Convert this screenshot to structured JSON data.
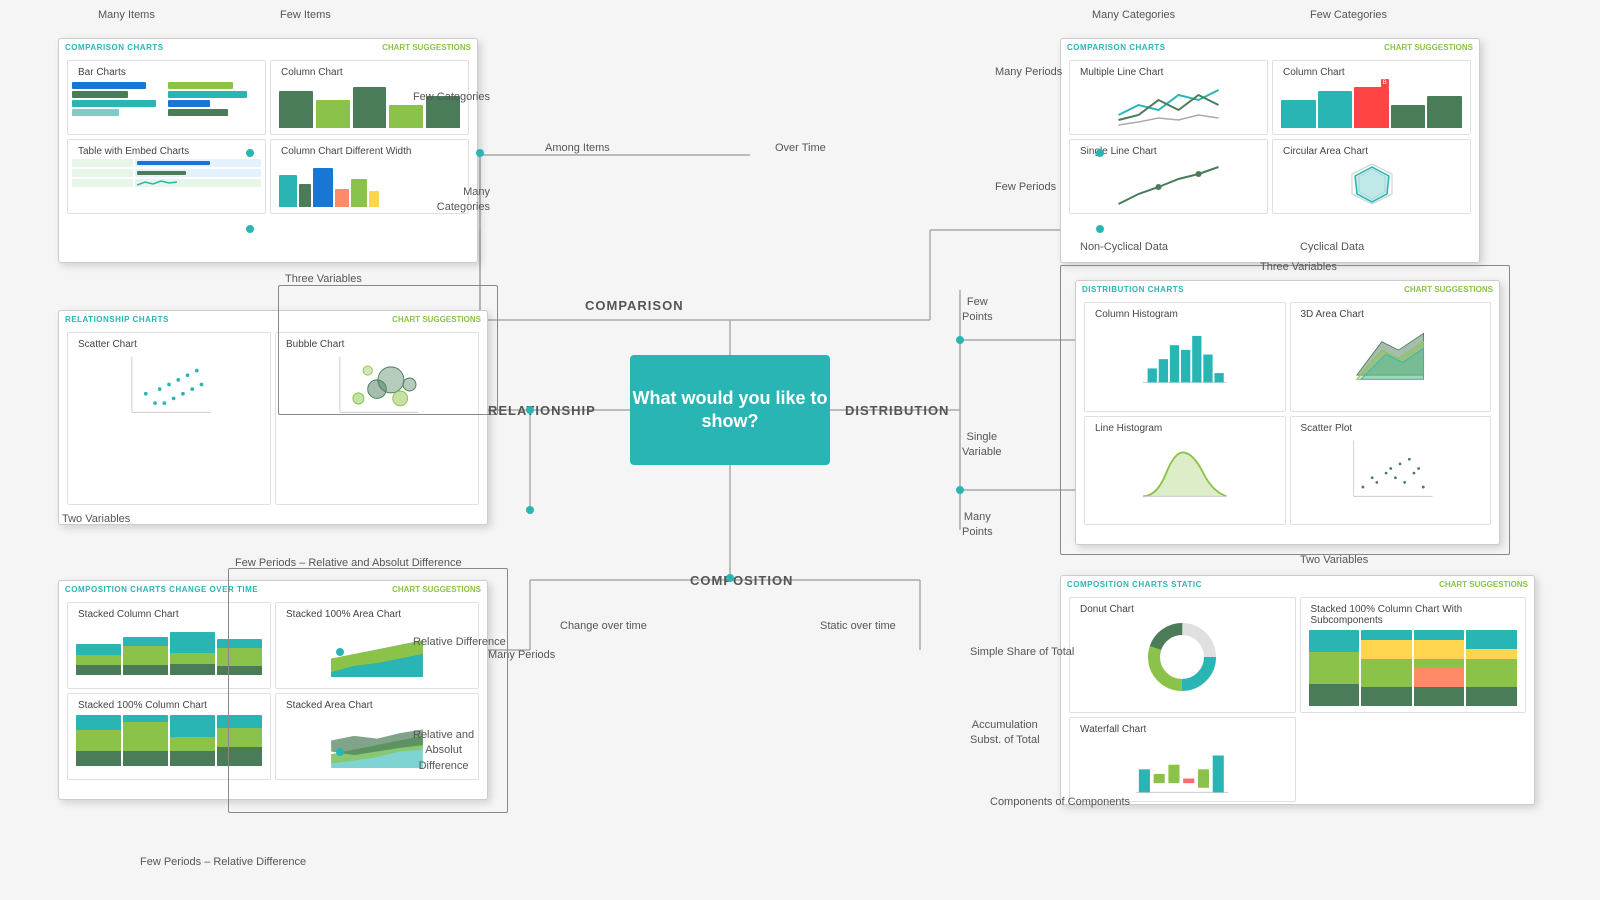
{
  "center": {
    "text": "What would you like to show?"
  },
  "directions": {
    "comparison": "COMPARISON",
    "relationship": "RELATIONSHIP",
    "distribution": "DISTRIBUTION",
    "composition": "COMPOSITION"
  },
  "connector_labels": {
    "among_items": "Among Items",
    "over_time": "Over Time",
    "change_over_time": "Change over time",
    "static_over_time": "Static over time",
    "many_items": "Many Items",
    "few_items": "Few Items",
    "many_categories": "Many Categories",
    "few_categories": "Few Categories",
    "few_periods_relative": "Few Periods – Relative Difference",
    "few_periods_absolute": "Few Periods – Relative and Absolut Difference",
    "many_periods": "Many Periods",
    "few_periods": "Few Periods",
    "few_points": "Few Points",
    "many_points": "Many Points",
    "single_variable": "Single Variable",
    "two_variables_rel": "Two Variables",
    "three_variables_rel": "Three Variables",
    "two_variables_dist": "Two Variables",
    "three_variables_dist": "Three Variables",
    "non_cyclical": "Non-Cyclical Data",
    "cyclical": "Cyclical Data",
    "many_periods_comp": "Many Periods",
    "simple_share": "Simple Share of Total",
    "accumulation": "Accumulation Subst. of Total",
    "components": "Components of Components",
    "relative_diff": "Relative Difference",
    "relative_absolut": "Relative and Absolut Difference"
  },
  "cards": {
    "comparison_top_left": {
      "type": "COMPARISON CHARTS",
      "suggestion": "CHART SUGGESTIONS",
      "charts": [
        {
          "title": "Bar Charts",
          "type": "bar_h"
        },
        {
          "title": "Column Chart",
          "type": "bar_v_green"
        },
        {
          "title": "Table with Embed Charts",
          "type": "table_embed"
        },
        {
          "title": "Column Chart Different Width",
          "type": "bar_v_multi"
        }
      ]
    },
    "comparison_top_right": {
      "type": "COMPARISON CHARTS",
      "suggestion": "CHART SUGGESTIONS",
      "charts": [
        {
          "title": "Multiple Line Chart",
          "type": "line_multi"
        },
        {
          "title": "Column Chart",
          "type": "bar_v_single"
        },
        {
          "title": "Single Line Chart",
          "type": "line_single"
        },
        {
          "title": "Circular Area Chart",
          "type": "radar"
        }
      ]
    },
    "relationship": {
      "type": "RELATIONSHIP CHARTS",
      "suggestion": "CHART SUGGESTIONS",
      "charts": [
        {
          "title": "Scatter Chart",
          "type": "scatter"
        },
        {
          "title": "Bubble Chart",
          "type": "bubble"
        }
      ]
    },
    "distribution": {
      "type": "DISTRIBUTION CHARTS",
      "suggestion": "CHART SUGGESTIONS",
      "charts": [
        {
          "title": "Column Histogram",
          "type": "histogram"
        },
        {
          "title": "3D Area Chart",
          "type": "area_3d"
        },
        {
          "title": "Line Histogram",
          "type": "line_hist"
        },
        {
          "title": "Scatter Plot",
          "type": "scatter_plot"
        }
      ]
    },
    "composition_bottom_left": {
      "type": "COMPOSITION CHARTS CHANGE OVER TIME",
      "suggestion": "CHART SUGGESTIONS",
      "charts": [
        {
          "title": "Stacked Column Chart",
          "type": "stacked_col"
        },
        {
          "title": "Stacked 100% Area Chart",
          "type": "stacked_area_100"
        },
        {
          "title": "Stacked 100% Column Chart",
          "type": "stacked_col_100"
        },
        {
          "title": "Stacked Area Chart",
          "type": "stacked_area"
        }
      ]
    },
    "composition_bottom_right": {
      "type": "COMPOSITION CHARTS STATIC",
      "suggestion": "CHART SUGGESTIONS",
      "charts": [
        {
          "title": "Donut Chart",
          "type": "donut"
        },
        {
          "title": "Stacked 100% Column Chart With Subcomponents",
          "type": "stacked_sub"
        },
        {
          "title": "Waterfall Chart",
          "type": "waterfall"
        }
      ]
    }
  },
  "colors": {
    "teal": "#2ab5b5",
    "green": "#8bc34a",
    "dark_green": "#4a7c59",
    "light_teal": "#80cbc4",
    "blue": "#1976d2",
    "yellow": "#ffd54f",
    "orange": "#ff8a65",
    "line_color": "#999",
    "text_dark": "#444",
    "text_medium": "#666",
    "text_light": "#888"
  }
}
